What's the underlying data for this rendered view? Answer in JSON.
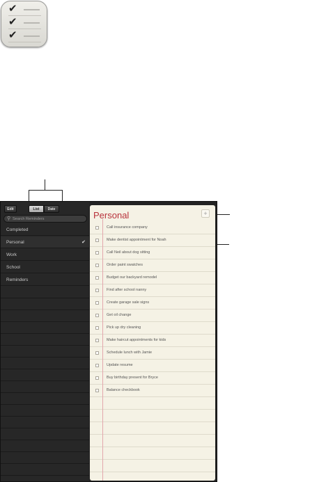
{
  "toolbar": {
    "edit_label": "Edit",
    "list_label": "List",
    "date_label": "Date"
  },
  "search": {
    "placeholder": "Search Reminders"
  },
  "lists": [
    {
      "label": "Completed",
      "selected": false
    },
    {
      "label": "Personal",
      "selected": true
    },
    {
      "label": "Work",
      "selected": false
    },
    {
      "label": "School",
      "selected": false
    },
    {
      "label": "Reminders",
      "selected": false
    }
  ],
  "main": {
    "title": "Personal",
    "add_label": "+",
    "tasks": [
      "Call insurance company",
      "Make dentist appointment for Noah",
      "Call Neil about dog sitting",
      "Order paint swatches",
      "Budget our backyard remodel",
      "Find after school nanny",
      "Create garage sale signs",
      "Get oil change",
      "Pick up dry cleaning",
      "Make haircut appointments for kids",
      "Schedule lunch with Jamie",
      "Update resume",
      "Buy birthday present for Bryce",
      "Balance checkbook"
    ]
  },
  "icons": {
    "check": "checkmark-icon",
    "search": "search-icon",
    "app": "reminders-app-icon"
  },
  "colors": {
    "title": "#b8323b",
    "paper": "#f5f2e5",
    "sidebar": "#272727"
  }
}
